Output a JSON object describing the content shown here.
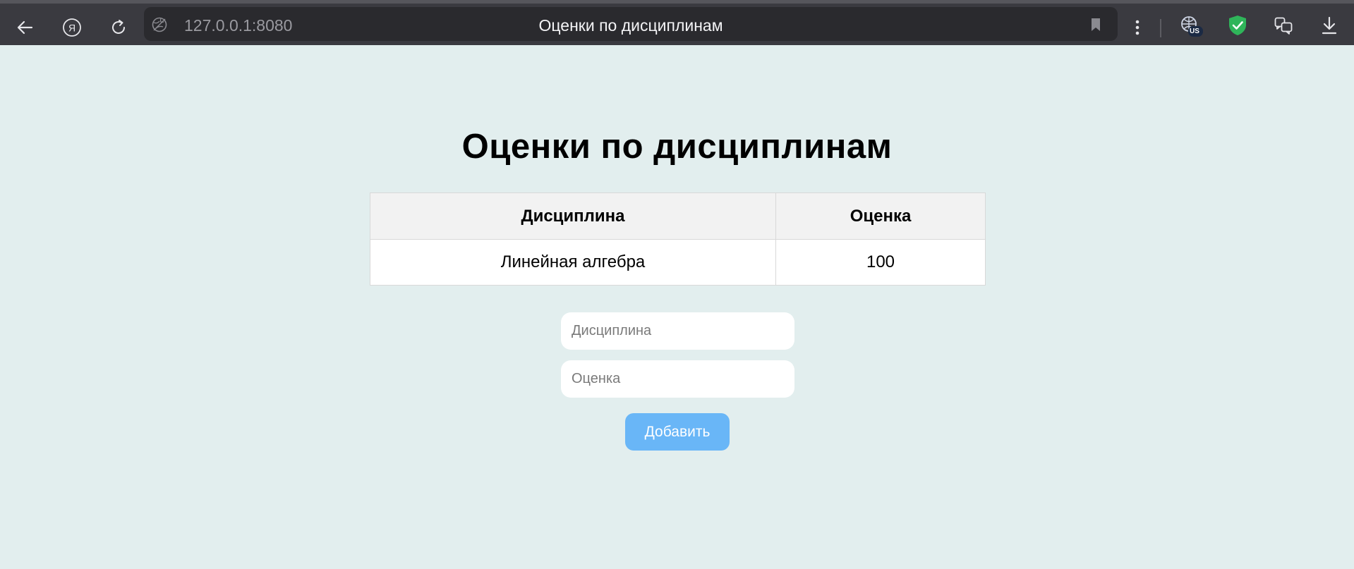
{
  "browser": {
    "url": "127.0.0.1:8080",
    "tab_title": "Оценки по дисциплинам",
    "vpn_badge": "US"
  },
  "page": {
    "title": "Оценки по дисциплинам",
    "table": {
      "headers": [
        "Дисциплина",
        "Оценка"
      ],
      "rows": [
        [
          "Линейная алгебра",
          "100"
        ]
      ]
    },
    "form": {
      "discipline_placeholder": "Дисциплина",
      "discipline_value": "",
      "grade_placeholder": "Оценка",
      "grade_value": "",
      "submit_label": "Добавить"
    }
  },
  "colors": {
    "page_bg": "#e2eeee",
    "chrome_bg": "#3a3a40",
    "button_bg": "#69b6f7",
    "shield_green": "#2fb55a"
  }
}
